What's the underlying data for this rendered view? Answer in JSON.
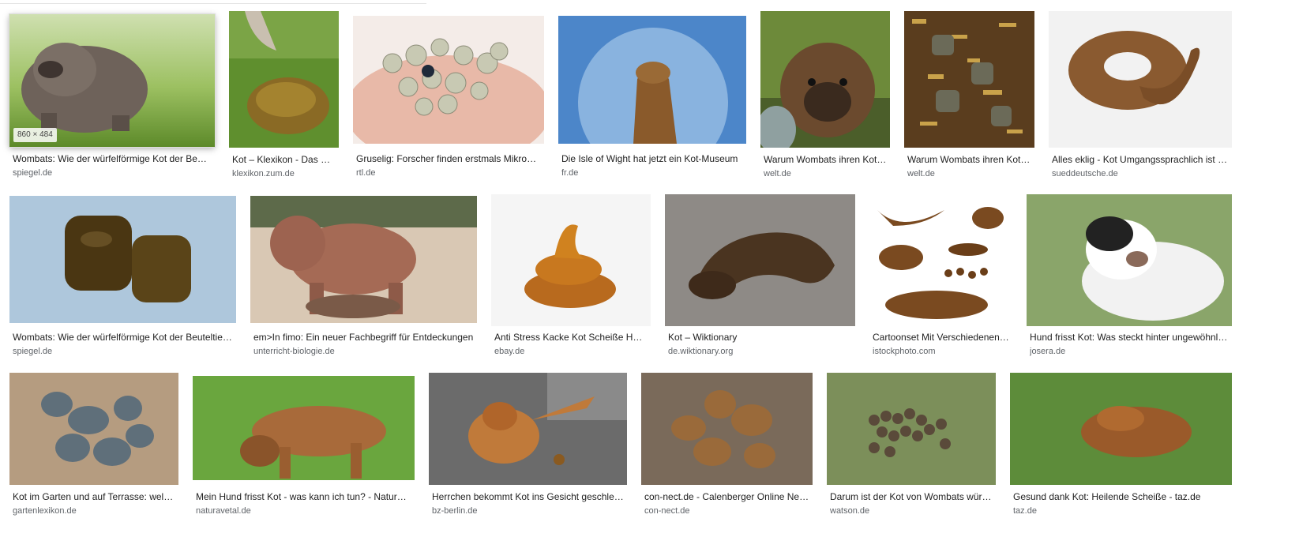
{
  "results": [
    {
      "title": "Wombats: Wie der würfelförmige Kot der Beuteltiere entsteht",
      "source": "spiegel.de",
      "dimensions": "860 × 484"
    },
    {
      "title": "Kot – Klexikon - Das Freie Kinderlexikon",
      "source": "klexikon.zum.de"
    },
    {
      "title": "Gruselig: Forscher finden erstmals Mikroplastik im menschlichen Kot",
      "source": "rtl.de"
    },
    {
      "title": "Die Isle of Wight hat jetzt ein Kot-Museum",
      "source": "fr.de"
    },
    {
      "title": "Warum Wombats ihren Kot würfeln",
      "source": "welt.de"
    },
    {
      "title": "Warum Wombats ihren Kot würfeln",
      "source": "welt.de"
    },
    {
      "title": "Alles eklig - Kot Umgangssprachlich ist Kot",
      "source": "sueddeutsche.de"
    },
    {
      "title": "Wombats: Wie der würfelförmige Kot der Beuteltiere entsteht",
      "source": "spiegel.de"
    },
    {
      "title": "em>In fimo: Ein neuer Fachbegriff für Entdeckungen",
      "source": "unterricht-biologie.de"
    },
    {
      "title": "Anti Stress Kacke Kot Scheiße Haufen",
      "source": "ebay.de"
    },
    {
      "title": "Kot – Wiktionary",
      "source": "de.wiktionary.org"
    },
    {
      "title": "Cartoonset Mit Verschiedenen Kothaufen",
      "source": "istockphoto.com"
    },
    {
      "title": "Hund frisst Kot: Was steckt hinter ungewöhnlichem Verhalten",
      "source": "josera.de"
    },
    {
      "title": "Kot im Garten und auf Terrasse: welche Tiere",
      "source": "gartenlexikon.de"
    },
    {
      "title": "Mein Hund frisst Kot - was kann ich tun? - Naturavetal",
      "source": "naturavetal.de"
    },
    {
      "title": "Herrchen bekommt Kot ins Gesicht geschleudert",
      "source": "bz-berlin.de"
    },
    {
      "title": "con-nect.de - Calenberger Online News",
      "source": "con-nect.de"
    },
    {
      "title": "Darum ist der Kot von Wombats würfelförmig",
      "source": "watson.de"
    },
    {
      "title": "Gesund dank Kot: Heilende Scheiße - taz.de",
      "source": "taz.de"
    }
  ]
}
